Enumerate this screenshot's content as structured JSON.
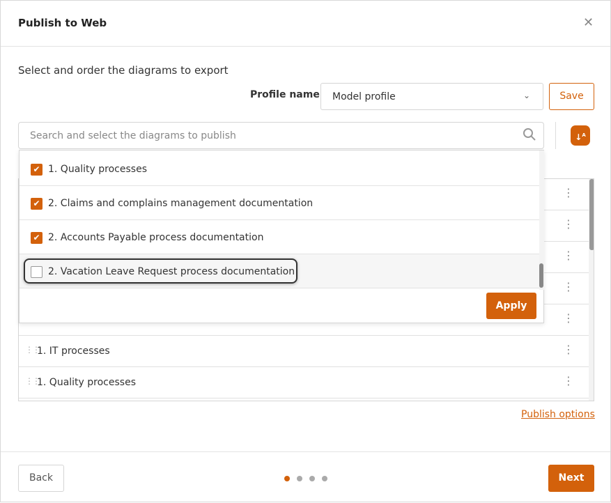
{
  "header": {
    "title": "Publish to Web",
    "close_icon": "close-icon"
  },
  "subtitle": "Select and order the diagrams to export",
  "profile": {
    "label": "Profile name",
    "value": "Model profile",
    "save_label": "Save"
  },
  "search": {
    "placeholder": "Search and select the diagrams to publish"
  },
  "dropdown": {
    "items": [
      {
        "label": "1. Quality processes",
        "checked": true
      },
      {
        "label": "2. Claims and complains management documentation",
        "checked": true
      },
      {
        "label": "2. Accounts Payable process documentation",
        "checked": true
      },
      {
        "label": "2. Vacation Leave Request process documentation",
        "checked": false
      }
    ],
    "apply_label": "Apply"
  },
  "list": {
    "items": [
      {
        "label": ""
      },
      {
        "label": ""
      },
      {
        "label": ""
      },
      {
        "label": ""
      },
      {
        "label": ""
      },
      {
        "label": "1. IT processes"
      },
      {
        "label": "1. Quality processes"
      }
    ]
  },
  "publish_options_label": "Publish options",
  "footer": {
    "back_label": "Back",
    "next_label": "Next",
    "steps": 4,
    "current_step": 1
  },
  "colors": {
    "accent": "#d3610b"
  }
}
